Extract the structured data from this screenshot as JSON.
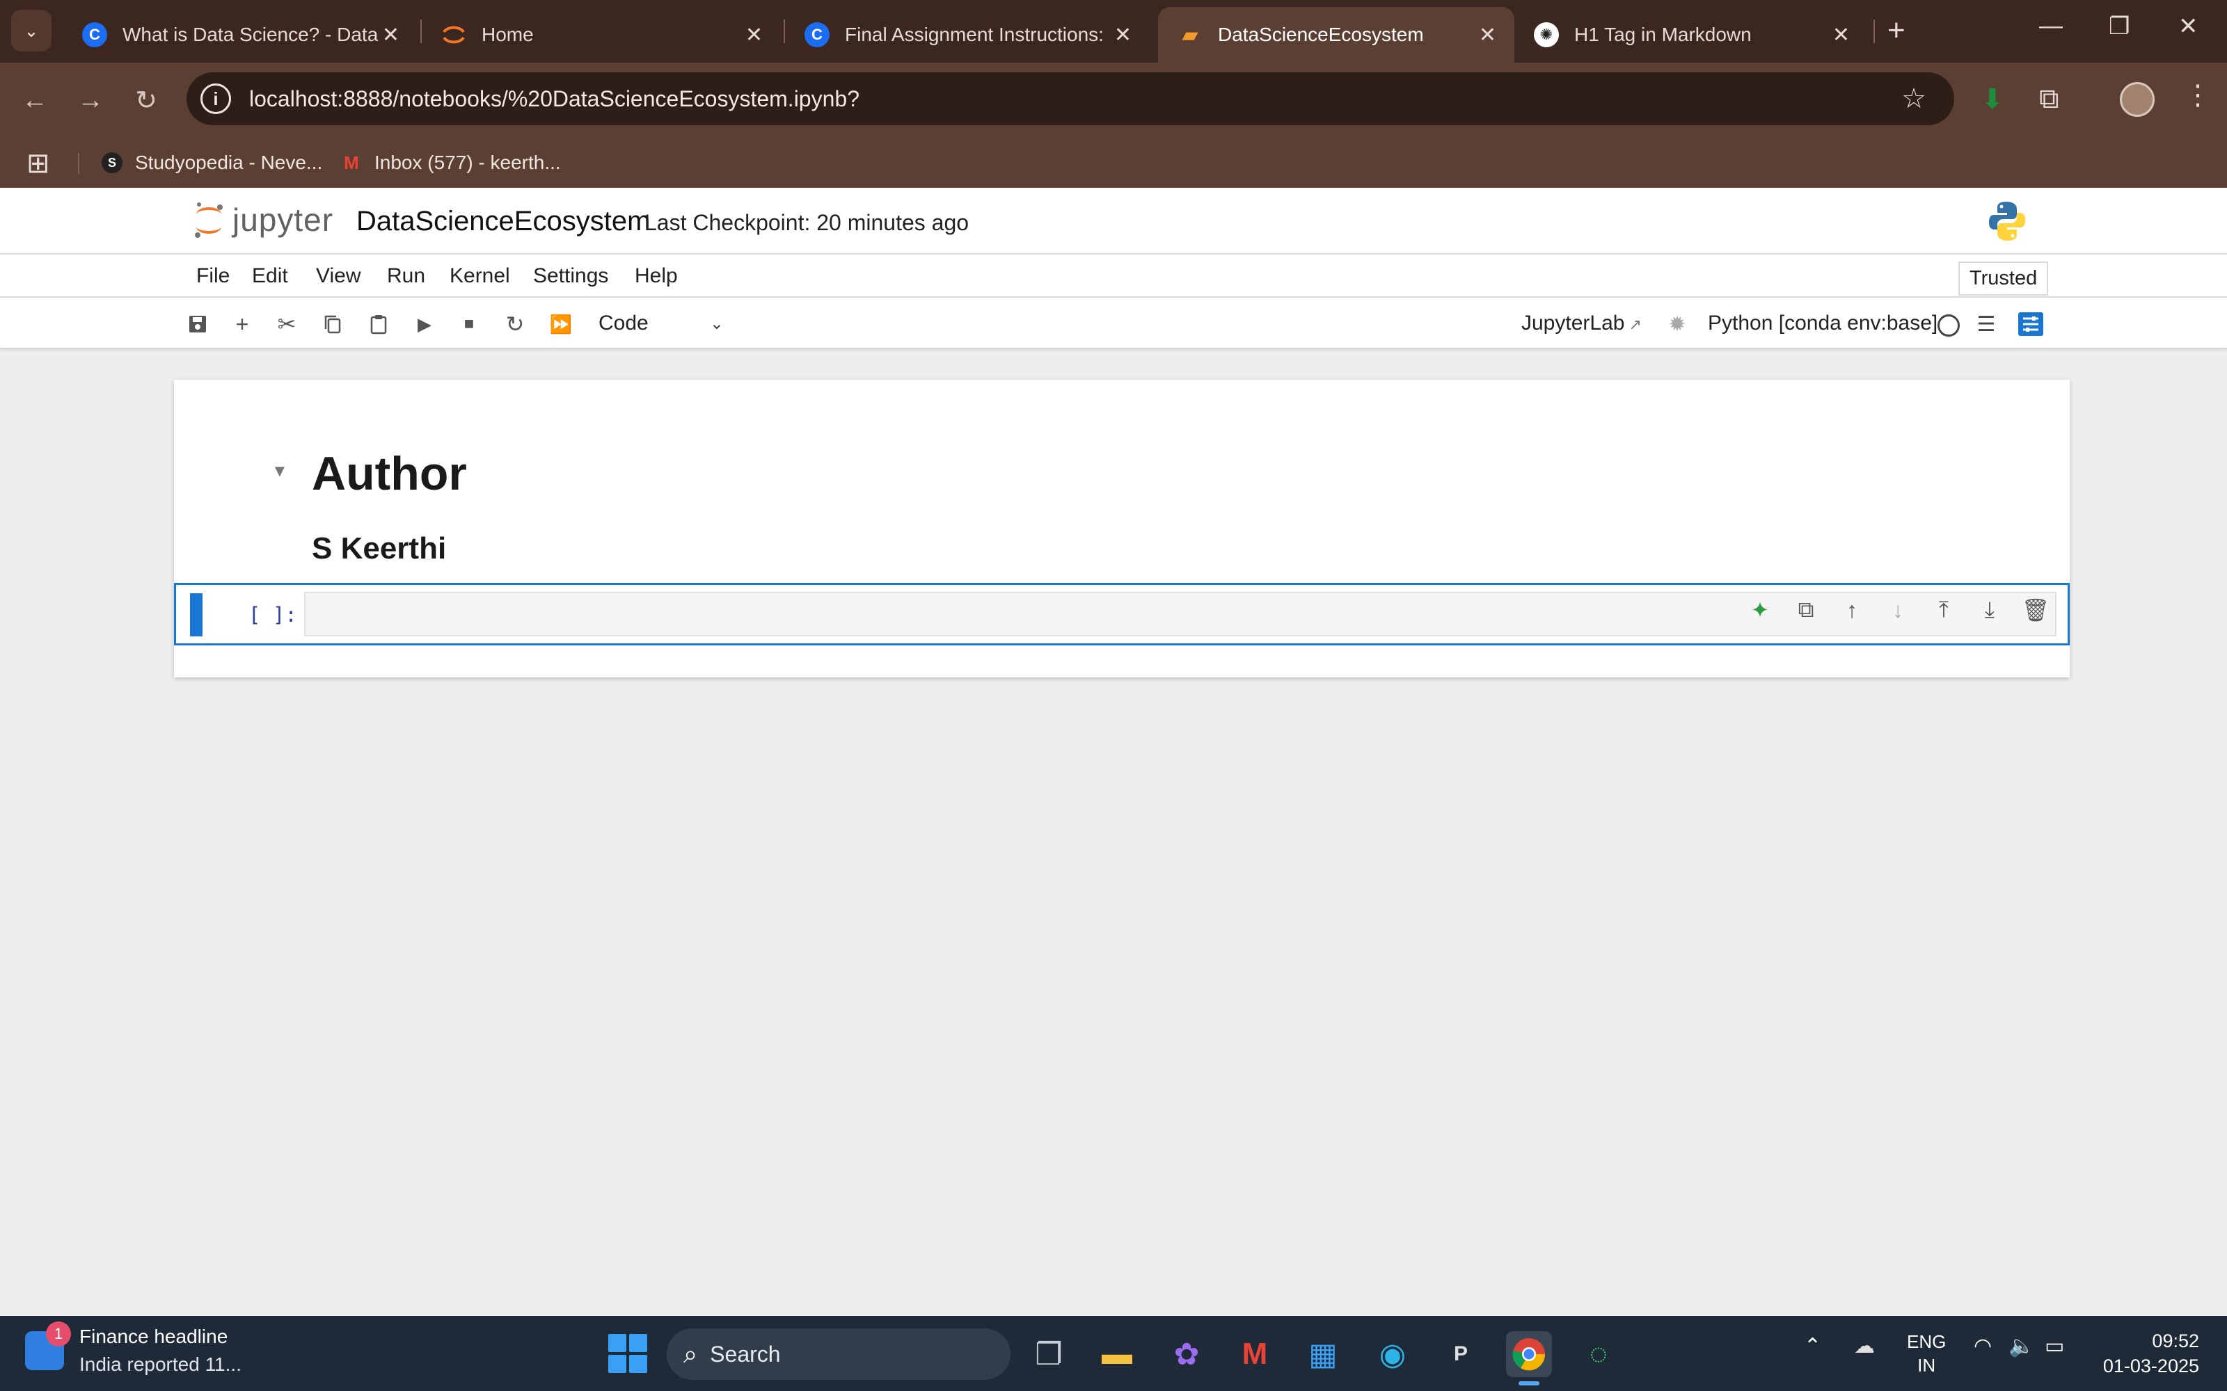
{
  "browser": {
    "tabs": [
      {
        "title": "What is Data Science? - Data Il",
        "favicon": "c-icon"
      },
      {
        "title": "Home",
        "favicon": "jupyter-icon"
      },
      {
        "title": "Final Assignment Instructions: I",
        "favicon": "c-icon"
      },
      {
        "title": "DataScienceEcosystem",
        "favicon": "notebook-icon",
        "active": true
      },
      {
        "title": "H1 Tag in Markdown",
        "favicon": "chatgpt-icon"
      }
    ],
    "url": "localhost:8888/notebooks/%20DataScienceEcosystem.ipynb?",
    "bookmarks": [
      {
        "label": "Studyopedia - Neve...",
        "icon": "studyopedia-icon"
      },
      {
        "label": "Inbox (577) - keerth...",
        "icon": "gmail-icon"
      }
    ],
    "colors": {
      "chrome_dark": "#3c2720",
      "chrome": "#5b3f33"
    }
  },
  "jupyter": {
    "logo_text": "jupyter",
    "notebook_name": "DataScienceEcosystem",
    "checkpoint": "Last Checkpoint: 20 minutes ago",
    "menu": [
      "File",
      "Edit",
      "View",
      "Run",
      "Kernel",
      "Settings",
      "Help"
    ],
    "trusted": "Trusted",
    "cell_type": "Code",
    "jupyterlab_link": "JupyterLab",
    "kernel": "Python [conda env:base]",
    "accent": "#1976d2"
  },
  "notebook": {
    "heading": "Author",
    "subheading": "S Keerthi",
    "code_prompt": "[ ]:",
    "code_value": ""
  },
  "taskbar": {
    "news_title": "Finance headline",
    "news_subtitle": "India reported 11...",
    "news_badge": "1",
    "search_label": "Search",
    "lang_line1": "ENG",
    "lang_line2": "IN",
    "time": "09:52",
    "date": "01-03-2025"
  }
}
